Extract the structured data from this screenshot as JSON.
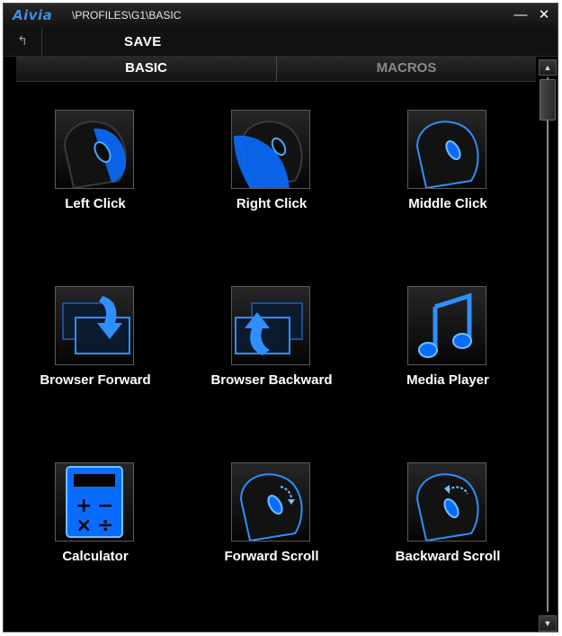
{
  "window": {
    "logo": "Aivia",
    "path": "\\PROFILES\\G1\\BASIC",
    "minimize_icon": "minimize-icon",
    "close_icon": "close-icon"
  },
  "toolbar": {
    "back_icon": "back-arrow-icon",
    "save_label": "SAVE"
  },
  "tabs": [
    {
      "label": "BASIC",
      "active": true
    },
    {
      "label": "MACROS",
      "active": false
    }
  ],
  "functions": [
    {
      "label": "Left Click",
      "icon": "mouse-left-click-icon"
    },
    {
      "label": "Right Click",
      "icon": "mouse-right-click-icon"
    },
    {
      "label": "Middle Click",
      "icon": "mouse-middle-click-icon"
    },
    {
      "label": "Browser Forward",
      "icon": "browser-forward-icon"
    },
    {
      "label": "Browser Backward",
      "icon": "browser-backward-icon"
    },
    {
      "label": "Media Player",
      "icon": "music-note-icon"
    },
    {
      "label": "Calculator",
      "icon": "calculator-icon"
    },
    {
      "label": "Forward Scroll",
      "icon": "mouse-scroll-forward-icon"
    },
    {
      "label": "Backward Scroll",
      "icon": "mouse-scroll-backward-icon"
    }
  ],
  "colors": {
    "accent_blue": "#2f8fff",
    "background": "#000000",
    "logo_blue": "#3e8fe6"
  }
}
